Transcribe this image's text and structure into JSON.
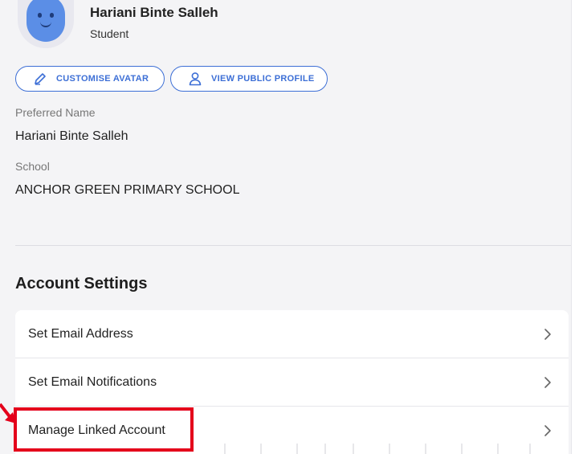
{
  "profile": {
    "name": "Hariani Binte Salleh",
    "role": "Student",
    "avatar_icon": "smiley-avatar-icon"
  },
  "actions": {
    "customise_avatar_label": "CUSTOMISE AVATAR",
    "customise_avatar_icon": "pencil-icon",
    "view_profile_label": "VIEW PUBLIC PROFILE",
    "view_profile_icon": "person-icon"
  },
  "fields": {
    "preferred_name_label": "Preferred Name",
    "preferred_name_value": "Hariani Binte Salleh",
    "school_label": "School",
    "school_value": "ANCHOR GREEN PRIMARY SCHOOL"
  },
  "account_settings": {
    "title": "Account Settings",
    "items": [
      {
        "label": "Set Email Address",
        "icon": "chevron-right-icon"
      },
      {
        "label": "Set Email Notifications",
        "icon": "chevron-right-icon"
      },
      {
        "label": "Manage Linked Account",
        "icon": "chevron-right-icon"
      }
    ]
  },
  "colors": {
    "accent": "#3d6fd6",
    "highlight": "#e4001b",
    "panel_bg": "#f4f4f6",
    "avatar": "#5b8ee6"
  }
}
